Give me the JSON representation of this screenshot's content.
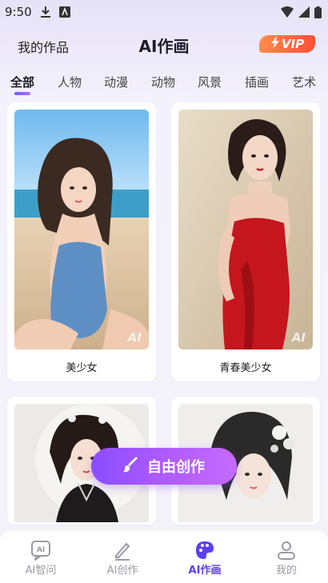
{
  "status_bar": {
    "time": "9:50"
  },
  "header": {
    "my_works": "我的作品",
    "title": "AI作画",
    "vip": "VIP"
  },
  "tabs": [
    "全部",
    "人物",
    "动漫",
    "动物",
    "风景",
    "插画",
    "艺术"
  ],
  "active_tab": 0,
  "cards": [
    {
      "label": "美少女",
      "watermark": "AI"
    },
    {
      "label": "青春美少女",
      "watermark": "AI"
    },
    {
      "label": "",
      "watermark": ""
    },
    {
      "label": "",
      "watermark": ""
    }
  ],
  "fab": {
    "label": "自由创作"
  },
  "bottom_nav": [
    {
      "label": "AI智问",
      "icon": "ai-chat-icon"
    },
    {
      "label": "AI创作",
      "icon": "pen-icon"
    },
    {
      "label": "AI作画",
      "icon": "palette-icon"
    },
    {
      "label": "我的",
      "icon": "user-icon"
    }
  ],
  "active_nav": 2,
  "colors": {
    "accent": "#5b3df5",
    "fab_gradient_start": "#8a4dff",
    "fab_gradient_end": "#c56bff",
    "vip_start": "#ff8c4a",
    "vip_end": "#ff4e36"
  }
}
